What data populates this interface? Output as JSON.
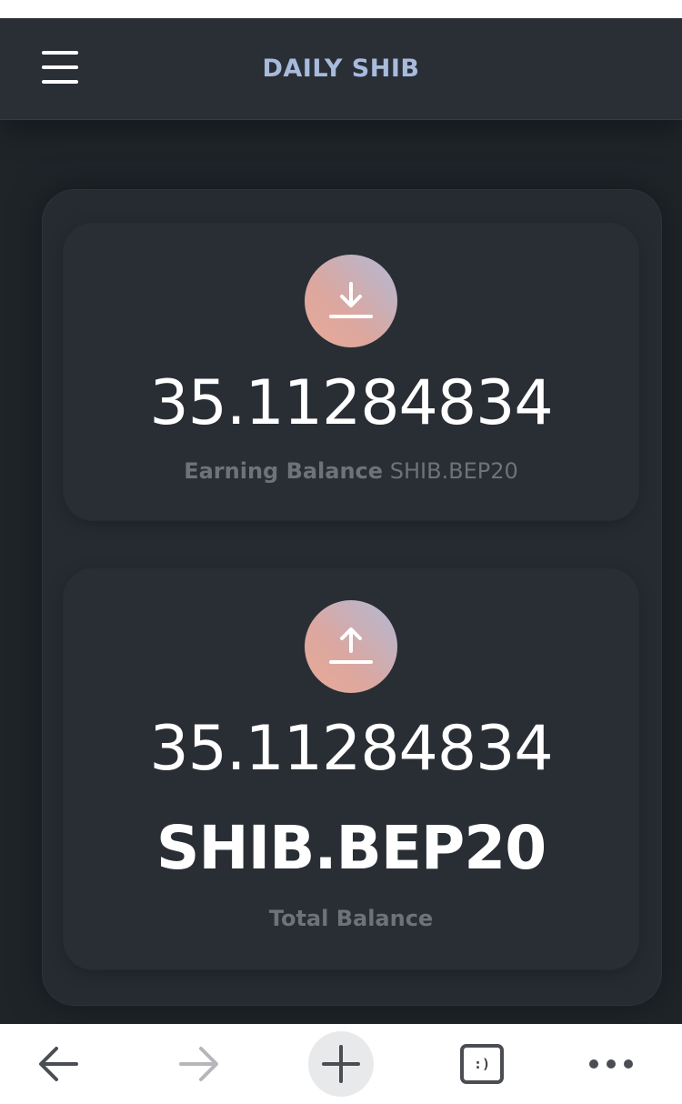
{
  "header": {
    "title": "DAILY SHIB",
    "menu_icon": "hamburger-menu-icon"
  },
  "earning": {
    "icon": "download-icon",
    "amount": "35.11284834",
    "label": "Earning Balance",
    "currency": "SHIB.BEP20"
  },
  "total": {
    "icon": "upload-icon",
    "amount": "35.11284834",
    "currency": "SHIB.BEP20",
    "label": "Total Balance"
  },
  "browser_bar": {
    "tabs_glyph": ":)",
    "icons": [
      "back-arrow-icon",
      "forward-arrow-icon",
      "plus-icon",
      "tabs-icon",
      "more-icon"
    ]
  },
  "colors": {
    "background": "#1f2429",
    "header": "#2a2f36",
    "card": "#262b32",
    "title": "#a8bbdd",
    "muted_text": "#6d737b",
    "icon_gradient_start": "#b2b9d6",
    "icon_gradient_end": "#e8aa98"
  }
}
